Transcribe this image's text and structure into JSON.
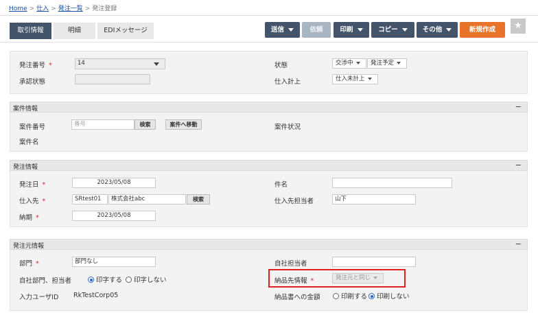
{
  "breadcrumb": {
    "home": "Home",
    "purchase": "仕入",
    "order_list": "発注一覧",
    "current": "発注登録"
  },
  "tabs": {
    "trade_info": "取引情報",
    "details": "明細",
    "edi_message": "EDIメッセージ"
  },
  "toolbar": {
    "send": "送信",
    "request": "依頼",
    "print": "印刷",
    "copy": "コピー",
    "other": "その他",
    "new": "新規作成"
  },
  "top_section": {
    "order_no_label": "発注番号",
    "order_no_value": "14",
    "approval_status_label": "承認状態",
    "status_label": "状態",
    "status_value_1": "交渉中",
    "status_value_2": "発注予定",
    "purchase_posting_label": "仕入計上",
    "purchase_posting_value": "仕入未計上"
  },
  "project": {
    "header": "案件情報",
    "collapse": "−",
    "no_label": "案件番号",
    "no_placeholder": "番号",
    "search_btn": "検索",
    "move_btn": "案件へ移動",
    "status_label": "案件状況",
    "name_label": "案件名"
  },
  "order_info": {
    "header": "発注情報",
    "collapse": "−",
    "date_label": "発注日",
    "date_value": "2023/05/08",
    "supplier_label": "仕入先",
    "supplier_code": "SRtest01",
    "supplier_name": "株式会社abc",
    "search_btn": "検索",
    "deadline_label": "納期",
    "deadline_value": "2023/05/08",
    "subject_label": "件名",
    "subject_value": "",
    "supplier_contact_label": "仕入先担当者",
    "supplier_contact_value": "山下"
  },
  "origin": {
    "header": "発注元情報",
    "collapse": "−",
    "dept_label": "部門",
    "dept_value": "部門なし",
    "company_rep_label": "自社担当者",
    "company_rep_value": "",
    "print_dept_label": "自社部門、担当者",
    "print_yes": "印字する",
    "print_no": "印字しない",
    "delivery_info_label": "納品先情報",
    "delivery_info_value": "発注元と同じ",
    "input_user_label": "入力ユーザID",
    "input_user_value": "RkTestCorp05",
    "amount_label": "納品書への金額",
    "amount_print": "印刷する",
    "amount_noprint": "印刷しない"
  },
  "required_mark": "*",
  "colors": {
    "nav": "#44546a",
    "accent": "#e7742a",
    "required": "#d9262b",
    "highlight": "#e0201f"
  }
}
